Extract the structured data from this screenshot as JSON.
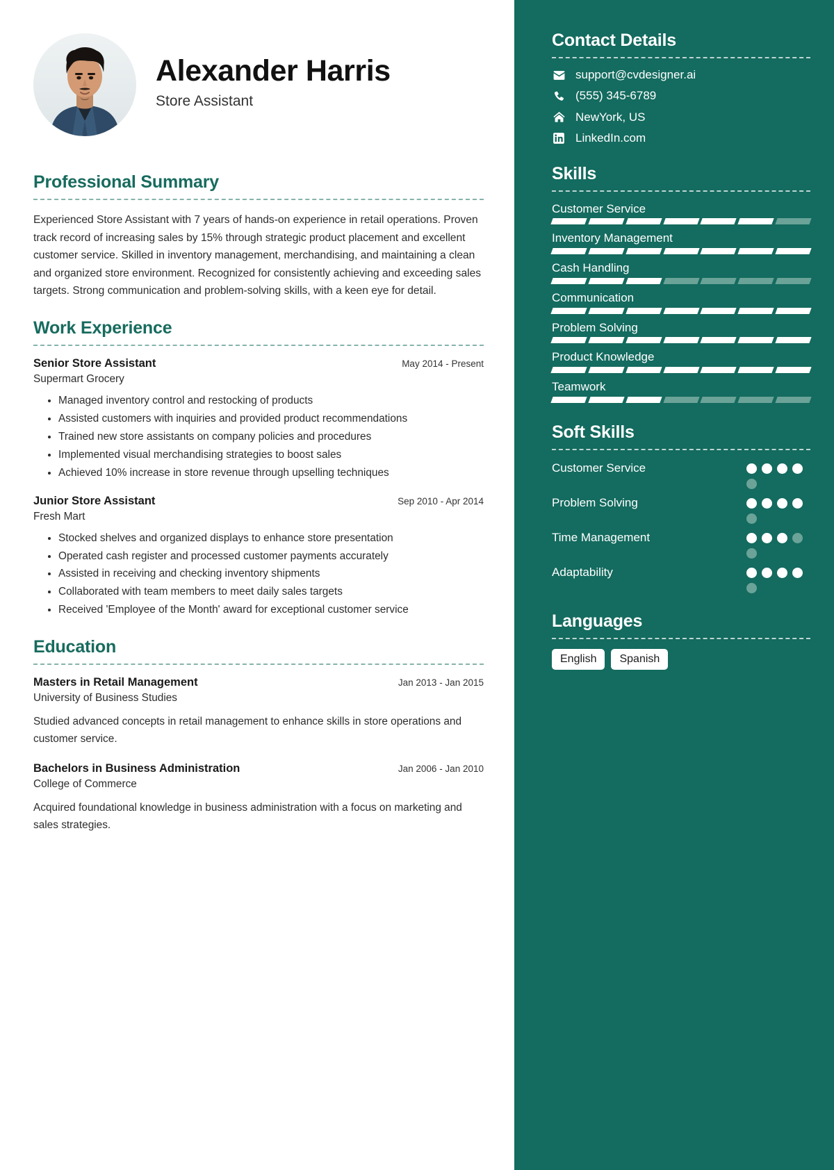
{
  "profile": {
    "name": "Alexander Harris",
    "role": "Store Assistant",
    "avatar_icon": "profile-photo"
  },
  "main": {
    "summary": {
      "title": "Professional Summary",
      "text": "Experienced Store Assistant with 7 years of hands-on experience in retail operations. Proven track record of increasing sales by 15% through strategic product placement and excellent customer service. Skilled in inventory management, merchandising, and maintaining a clean and organized store environment. Recognized for consistently achieving and exceeding sales targets. Strong communication and problem-solving skills, with a keen eye for detail."
    },
    "work": {
      "title": "Work Experience",
      "jobs": [
        {
          "title": "Senior Store Assistant",
          "dates": "May 2014 - Present",
          "org": "Supermart Grocery",
          "bullets": [
            "Managed inventory control and restocking of products",
            "Assisted customers with inquiries and provided product recommendations",
            "Trained new store assistants on company policies and procedures",
            "Implemented visual merchandising strategies to boost sales",
            "Achieved 10% increase in store revenue through upselling techniques"
          ]
        },
        {
          "title": "Junior Store Assistant",
          "dates": "Sep 2010 - Apr 2014",
          "org": "Fresh Mart",
          "bullets": [
            "Stocked shelves and organized displays to enhance store presentation",
            "Operated cash register and processed customer payments accurately",
            "Assisted in receiving and checking inventory shipments",
            "Collaborated with team members to meet daily sales targets",
            "Received 'Employee of the Month' award for exceptional customer service"
          ]
        }
      ]
    },
    "education": {
      "title": "Education",
      "items": [
        {
          "degree": "Masters in Retail Management",
          "dates": "Jan 2013 - Jan 2015",
          "school": "University of Business Studies",
          "description": "Studied advanced concepts in retail management to enhance skills in store operations and customer service."
        },
        {
          "degree": "Bachelors in Business Administration",
          "dates": "Jan 2006 - Jan 2010",
          "school": "College of Commerce",
          "description": "Acquired foundational knowledge in business administration with a focus on marketing and sales strategies."
        }
      ]
    }
  },
  "sidebar": {
    "contact": {
      "title": "Contact Details",
      "items": [
        {
          "icon": "envelope-icon",
          "value": "support@cvdesigner.ai"
        },
        {
          "icon": "phone-icon",
          "value": "(555) 345-6789"
        },
        {
          "icon": "home-icon",
          "value": "NewYork, US"
        },
        {
          "icon": "linkedin-icon",
          "value": "LinkedIn.com"
        }
      ]
    },
    "skills": {
      "title": "Skills",
      "total_segments": 7,
      "items": [
        {
          "name": "Customer Service",
          "filled": 6
        },
        {
          "name": "Inventory Management",
          "filled": 7
        },
        {
          "name": "Cash Handling",
          "filled": 3
        },
        {
          "name": "Communication",
          "filled": 7
        },
        {
          "name": "Problem Solving",
          "filled": 7
        },
        {
          "name": "Product Knowledge",
          "filled": 7
        },
        {
          "name": "Teamwork",
          "filled": 3
        }
      ]
    },
    "soft_skills": {
      "title": "Soft Skills",
      "total_dots": 5,
      "items": [
        {
          "name": "Customer Service",
          "filled": 4
        },
        {
          "name": "Problem Solving",
          "filled": 4
        },
        {
          "name": "Time Management",
          "filled": 3
        },
        {
          "name": "Adaptability",
          "filled": 4
        }
      ]
    },
    "languages": {
      "title": "Languages",
      "items": [
        "English",
        "Spanish"
      ]
    }
  },
  "colors": {
    "accent": "#176b5e",
    "sidebar_bg": "#146B5F",
    "segment_off": "#6ba398"
  }
}
